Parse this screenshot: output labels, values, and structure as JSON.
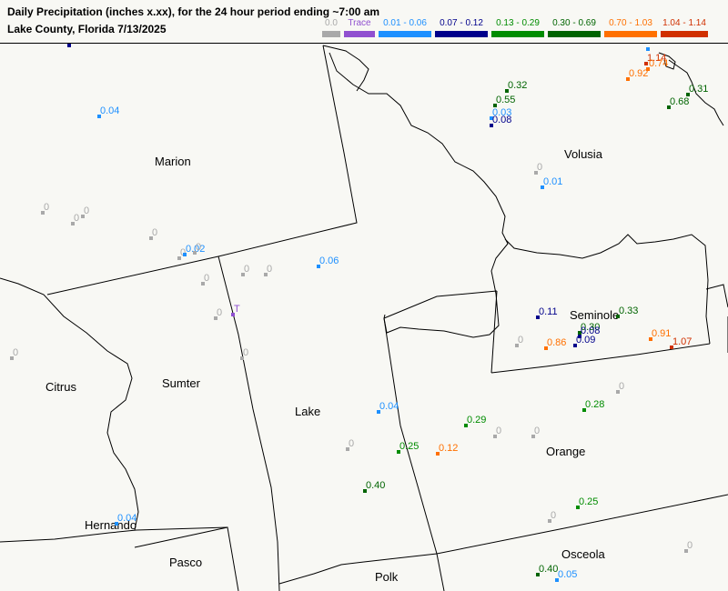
{
  "header": {
    "title_line1": "Daily Precipitation (inches  x.xx),  for the 24 hour period ending ~7:00 am",
    "title_line2": "Lake County, Florida  7/13/2025"
  },
  "legend": [
    {
      "label": "0.0",
      "color": "#a9a9a9"
    },
    {
      "label": "Trace",
      "color": "#9050d0"
    },
    {
      "label": "0.01 - 0.06",
      "color": "#1e90ff"
    },
    {
      "label": "0.07 - 0.12",
      "color": "#00008b"
    },
    {
      "label": "0.13 - 0.29",
      "color": "#008c00"
    },
    {
      "label": "0.30 - 0.69",
      "color": "#006400"
    },
    {
      "label": "0.70 - 1.03",
      "color": "#ff7000"
    },
    {
      "label": "1.04 - 1.14",
      "color": "#d03000"
    }
  ],
  "counties": [
    "Marion",
    "Volusia",
    "Citrus",
    "Sumter",
    "Lake",
    "Seminole",
    "Orange",
    "Hernando",
    "Pasco",
    "Polk",
    "Osceola"
  ],
  "observations": [
    {
      "value": "0.04",
      "cat": 2
    },
    {
      "value": "0.32",
      "cat": 5
    },
    {
      "value": "0.55",
      "cat": 5
    },
    {
      "value": "0.03",
      "cat": 2
    },
    {
      "value": "0.08",
      "cat": 3
    },
    {
      "value": "0.92",
      "cat": 6
    },
    {
      "value": "1.14",
      "cat": 7
    },
    {
      "value": "0.74",
      "cat": 6
    },
    {
      "value": "0.68",
      "cat": 5
    },
    {
      "value": "0.31",
      "cat": 5
    },
    {
      "value": "0",
      "cat": 0
    },
    {
      "value": "0.01",
      "cat": 2
    },
    {
      "value": "0",
      "cat": 0
    },
    {
      "value": "0",
      "cat": 0
    },
    {
      "value": "0",
      "cat": 0
    },
    {
      "value": "0",
      "cat": 0
    },
    {
      "value": "0",
      "cat": 0
    },
    {
      "value": "0.02",
      "cat": 2
    },
    {
      "value": "0",
      "cat": 0
    },
    {
      "value": "0",
      "cat": 0
    },
    {
      "value": "0.06",
      "cat": 2
    },
    {
      "value": "0",
      "cat": 0
    },
    {
      "value": "0",
      "cat": 0
    },
    {
      "value": "T",
      "cat": 1
    },
    {
      "value": "0",
      "cat": 0
    },
    {
      "value": "0",
      "cat": 0
    },
    {
      "value": "0",
      "cat": 0
    },
    {
      "value": "0.11",
      "cat": 3
    },
    {
      "value": "0.33",
      "cat": 5
    },
    {
      "value": "0.30",
      "cat": 5
    },
    {
      "value": "0.08",
      "cat": 3
    },
    {
      "value": "0.09",
      "cat": 3
    },
    {
      "value": "0",
      "cat": 0
    },
    {
      "value": "0.91",
      "cat": 6
    },
    {
      "value": "1.07",
      "cat": 7
    },
    {
      "value": "0",
      "cat": 0
    },
    {
      "value": "0.04",
      "cat": 2
    },
    {
      "value": "0.28",
      "cat": 4
    },
    {
      "value": "0.29",
      "cat": 4
    },
    {
      "value": "0",
      "cat": 0
    },
    {
      "value": "0",
      "cat": 0
    },
    {
      "value": "0",
      "cat": 0
    },
    {
      "value": "0.25",
      "cat": 4
    },
    {
      "value": "0.12",
      "cat": 6
    },
    {
      "value": "0.40",
      "cat": 5
    },
    {
      "value": "0.86",
      "cat": 6
    },
    {
      "value": "0",
      "cat": 0
    },
    {
      "value": "0.25",
      "cat": 4
    },
    {
      "value": "0",
      "cat": 0
    },
    {
      "value": "0.40",
      "cat": 5
    },
    {
      "value": "0.05",
      "cat": 2
    },
    {
      "value": "0.04",
      "cat": 2
    }
  ]
}
